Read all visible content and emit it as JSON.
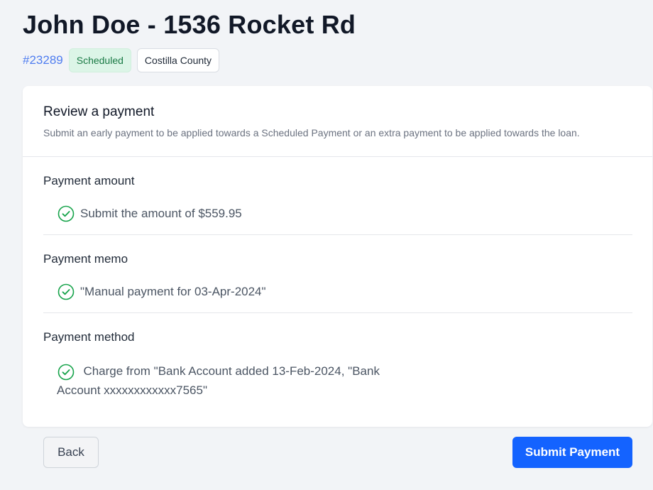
{
  "header": {
    "title": "John Doe - 1536 Rocket Rd",
    "id": "#23289",
    "status_badge": "Scheduled",
    "county_badge": "Costilla County"
  },
  "card": {
    "title": "Review a payment",
    "description": "Submit an early payment to be applied towards a Scheduled Payment or an extra payment to be applied towards the loan.",
    "sections": [
      {
        "label": "Payment amount",
        "value": "Submit the amount of $559.95"
      },
      {
        "label": "Payment memo",
        "value": "\"Manual payment for 03-Apr-2024\""
      },
      {
        "label": "Payment method",
        "value": "Charge from \"Bank Account added 13-Feb-2024, \"Bank Account xxxxxxxxxxxx7565\""
      }
    ]
  },
  "actions": {
    "back_label": "Back",
    "submit_label": "Submit Payment"
  },
  "colors": {
    "accent": "#1463ff",
    "link": "#4f7df0",
    "success": "#16a34a",
    "badge_success_bg": "#dcf5e7"
  },
  "icons": {
    "check": "check-circle-icon"
  }
}
